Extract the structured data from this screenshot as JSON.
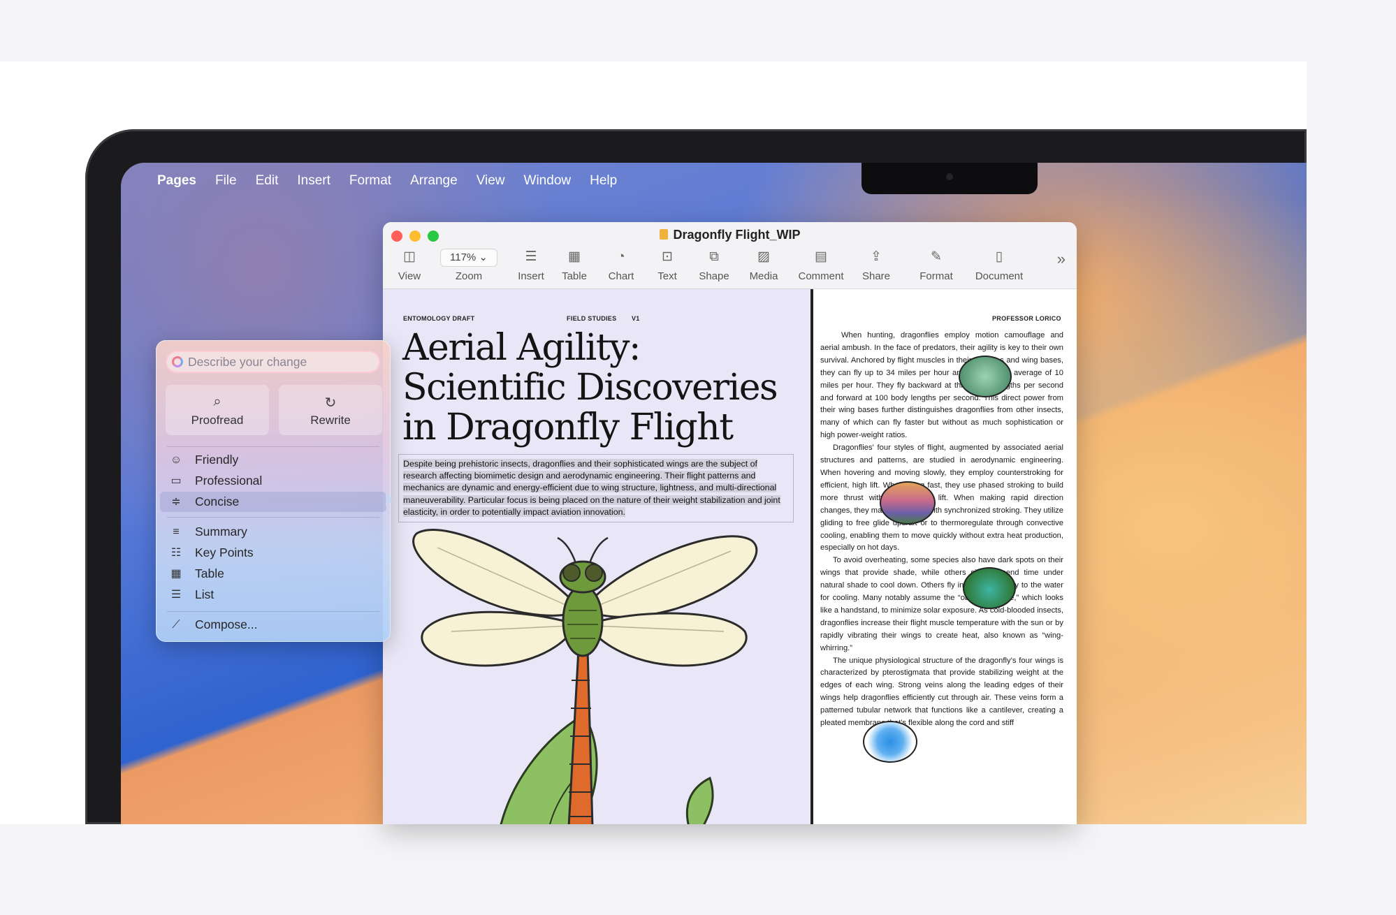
{
  "menubar": {
    "apple_glyph": "",
    "items": [
      "Pages",
      "File",
      "Edit",
      "Insert",
      "Format",
      "Arrange",
      "View",
      "Window",
      "Help"
    ]
  },
  "window": {
    "title": "Dragonfly Flight_WIP",
    "toolbar": {
      "view": "View",
      "zoom_value": "117% ⌄",
      "zoom": "Zoom",
      "insert": "Insert",
      "table": "Table",
      "chart": "Chart",
      "text": "Text",
      "shape": "Shape",
      "media": "Media",
      "comment": "Comment",
      "share": "Share",
      "format": "Format",
      "document": "Document"
    }
  },
  "left_page": {
    "header_left": "ENTOMOLOGY DRAFT",
    "header_mid": "FIELD STUDIES",
    "header_v": "V1",
    "headline": "Aerial Agility: Scientific Discoveries in Dragonfly Flight",
    "intro": "Despite being prehistoric insects, dragonflies and their sophisticated wings are the subject of research affecting biomimetic design and aerodynamic engineering. Their flight patterns and mechanics are dynamic and energy-efficient due to wing structure, lightness, and multi-directional maneuverability. Particular focus is being placed on the nature of their weight stabilization and joint elasticity, in order to potentially impact aviation innovation."
  },
  "right_page": {
    "header": "PROFESSOR LORICO",
    "paragraphs": [
      "When hunting, dragonflies employ motion camouflage and aerial ambush. In the face of predators, their agility is key to their own survival. Anchored by flight muscles in their thoraxes and wing bases, they can fly up to 34 miles per hour and cruise at an average of 10 miles per hour. They fly backward at three body lengths per second and forward at 100 body lengths per second. This direct power from their wing bases further distinguishes dragonflies from other insects, many of which can fly faster but without as much sophistication or high power-weight ratios.",
      "Dragonflies' four styles of flight, augmented by associated aerial structures and patterns, are studied in aerodynamic engineering. When hovering and moving slowly, they employ counterstroking for efficient, high lift. When flying fast, they use phased stroking to build more thrust without as much lift. When making rapid direction changes, they maximize thrust with synchronized stroking. They utilize gliding to free glide updraft or to thermoregulate through convective cooling, enabling them to move quickly without extra heat production, especially on hot days.",
      "To avoid overheating, some species also have dark spots on their wings that provide shade, while others simply spend time under natural shade to cool down. Others fly in close proximity to the water for cooling. Many notably assume the “obelisk posture,” which looks like a handstand, to minimize solar exposure. As cold-blooded insects, dragonflies increase their flight muscle temperature with the sun or by rapidly vibrating their wings to create heat, also known as “wing-whirring.”",
      "The unique physiological structure of the dragonfly’s four wings is characterized by pterostigmata that provide stabilizing weight at the edges of each wing. Strong veins along the leading edges of their wings help dragonflies efficiently cut through air. These veins form a patterned tubular network that functions like a cantilever, creating a pleated membrane that’s flexible along the cord and stiff"
    ]
  },
  "writing_tools": {
    "placeholder": "Describe your change",
    "proofread": "Proofread",
    "rewrite": "Rewrite",
    "options": [
      {
        "icon": "☺",
        "label": "Friendly"
      },
      {
        "icon": "▭",
        "label": "Professional"
      },
      {
        "icon": "≑",
        "label": "Concise"
      }
    ],
    "options2": [
      {
        "icon": "≡",
        "label": "Summary"
      },
      {
        "icon": "☷",
        "label": "Key Points"
      },
      {
        "icon": "▦",
        "label": "Table"
      },
      {
        "icon": "☰",
        "label": "List"
      }
    ],
    "compose": "Compose..."
  },
  "colors": {
    "close": "#ff5f57",
    "minimize": "#febc2e",
    "zoom": "#28c840"
  }
}
